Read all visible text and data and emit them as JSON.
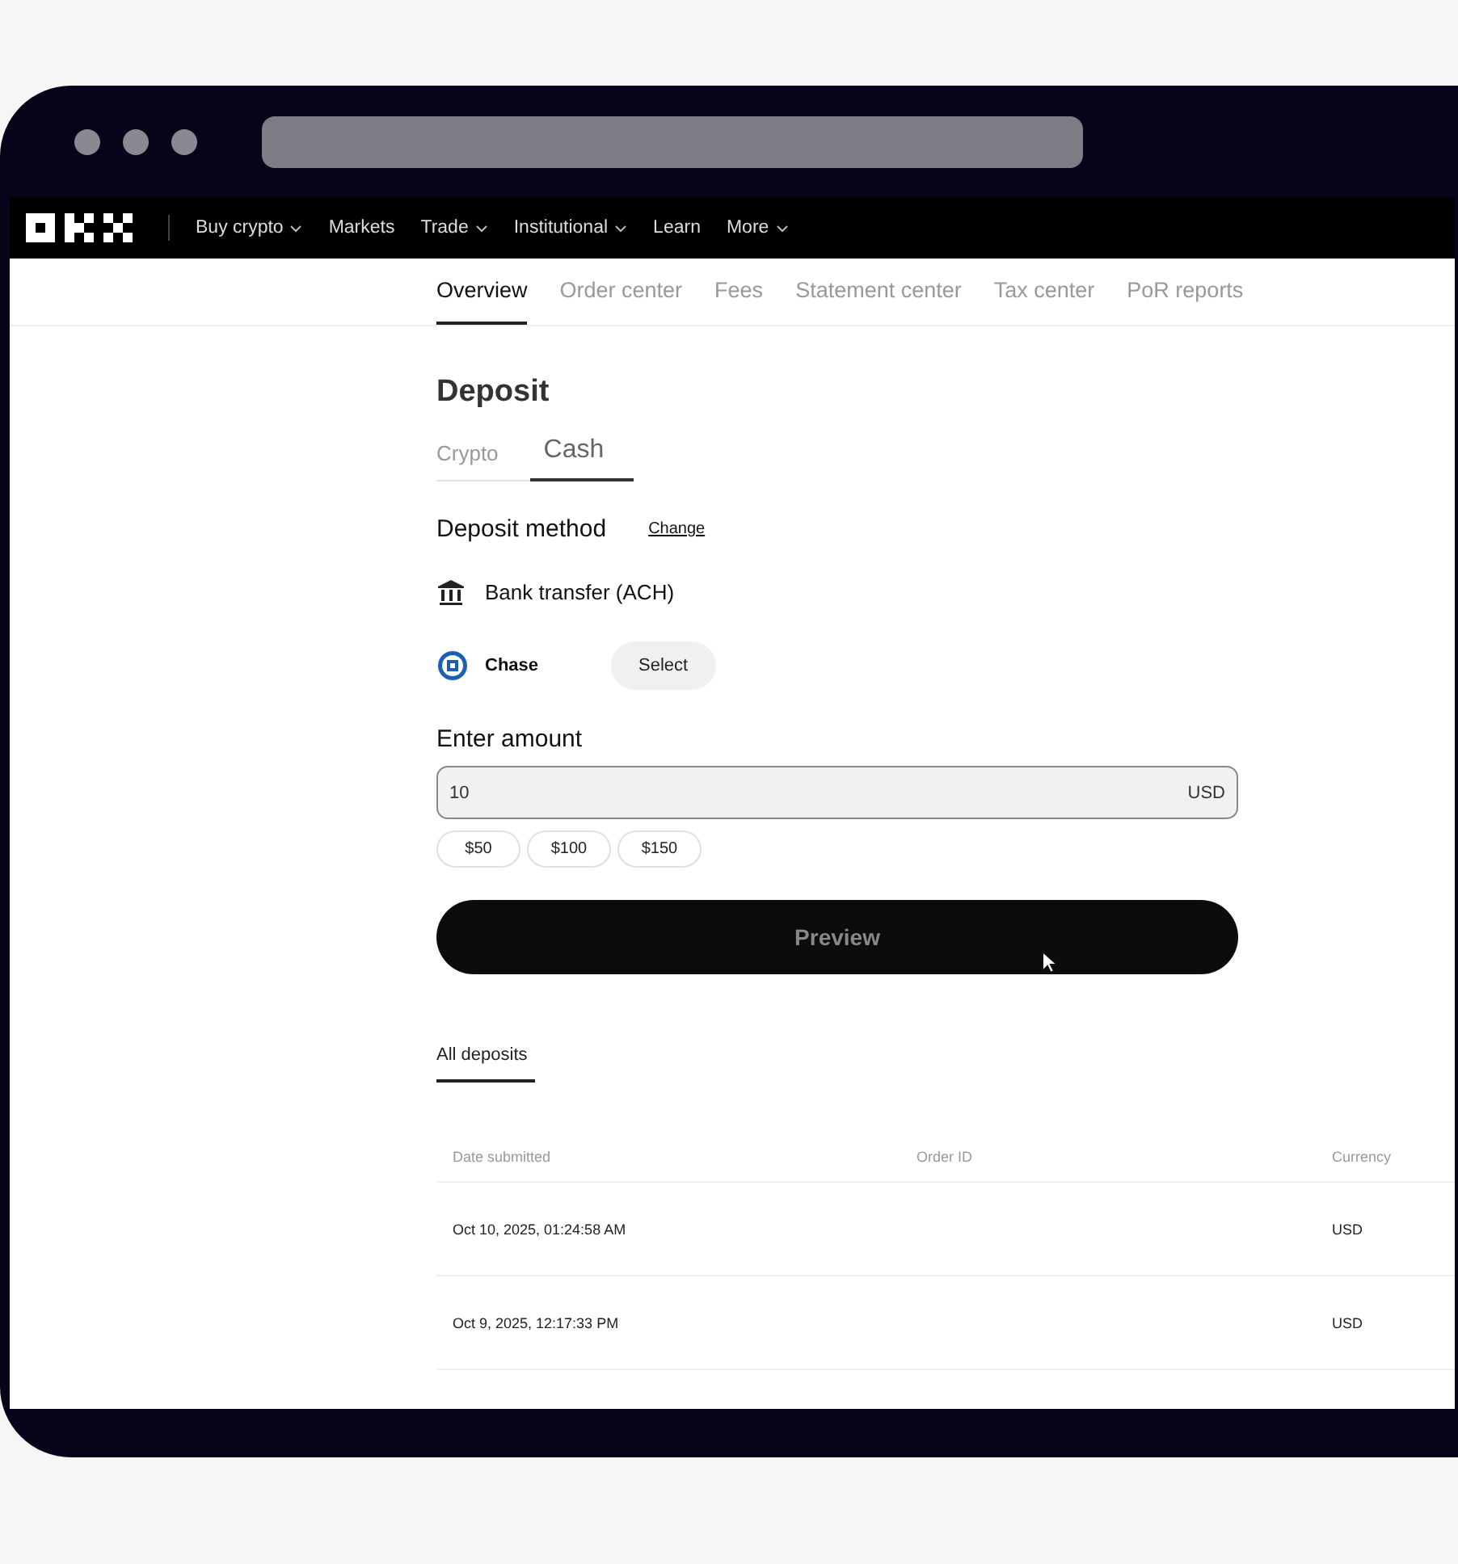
{
  "nav": {
    "items": [
      {
        "label": "Buy crypto",
        "dropdown": true
      },
      {
        "label": "Markets",
        "dropdown": false
      },
      {
        "label": "Trade",
        "dropdown": true
      },
      {
        "label": "Institutional",
        "dropdown": true
      },
      {
        "label": "Learn",
        "dropdown": false
      },
      {
        "label": "More",
        "dropdown": true
      }
    ]
  },
  "subnav": [
    {
      "label": "Overview",
      "selected": true
    },
    {
      "label": "Order center",
      "selected": false
    },
    {
      "label": "Fees",
      "selected": false
    },
    {
      "label": "Statement center",
      "selected": false
    },
    {
      "label": "Tax center",
      "selected": false
    },
    {
      "label": "PoR reports",
      "selected": false
    }
  ],
  "deposit": {
    "title": "Deposit",
    "tabs": [
      {
        "label": "Crypto",
        "selected": false
      },
      {
        "label": "Cash",
        "selected": true
      }
    ],
    "method_label": "Deposit method",
    "change_link": "Change",
    "method": "Bank transfer (ACH)",
    "bank": {
      "name": "Chase",
      "button": "Select"
    },
    "amount_label": "Enter amount",
    "amount": {
      "value": "10",
      "currency": "USD"
    },
    "quick_amounts": [
      "$50",
      "$100",
      "$150"
    ],
    "preview_button": {
      "label": "Preview",
      "disabled": true
    }
  },
  "history": {
    "tabs": [
      {
        "label": "All deposits",
        "selected": true
      }
    ],
    "columns": [
      "Date submitted",
      "Order ID",
      "Currency"
    ],
    "rows": [
      {
        "date": "Oct 10, 2025, 01:24:58 AM",
        "currency": "USD"
      },
      {
        "date": "Oct 9, 2025, 12:17:33 PM",
        "currency": "USD"
      }
    ]
  }
}
